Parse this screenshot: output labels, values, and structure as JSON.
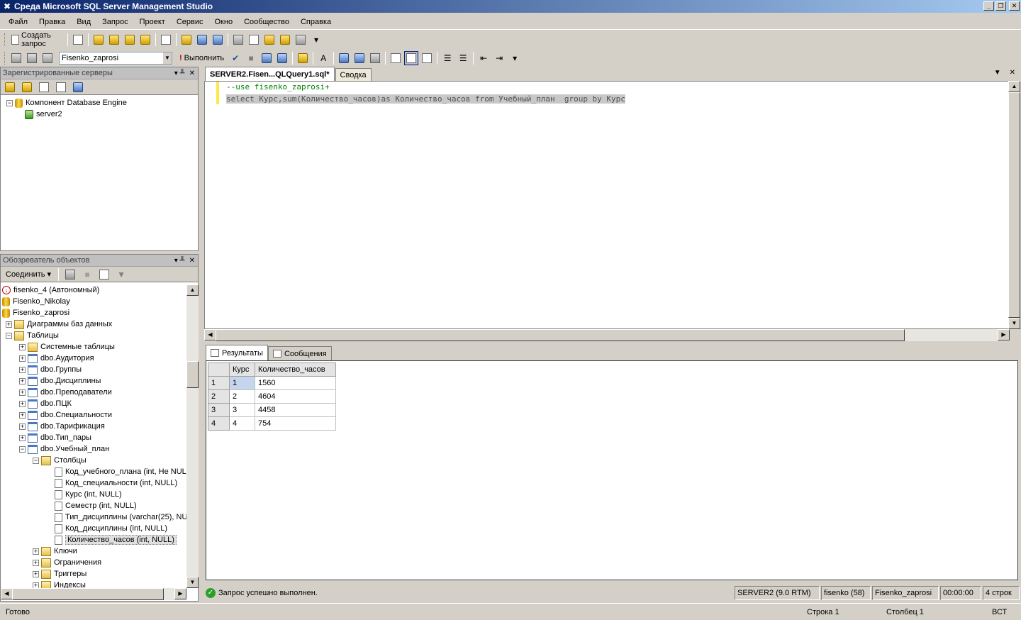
{
  "window": {
    "title": "Среда Microsoft SQL Server Management Studio",
    "minimize": "_",
    "restore": "❐",
    "close": "✕"
  },
  "menu": [
    "Файл",
    "Правка",
    "Вид",
    "Запрос",
    "Проект",
    "Сервис",
    "Окно",
    "Сообщество",
    "Справка"
  ],
  "toolbar": {
    "new_query": "Создать запрос",
    "database": "Fisenko_zaprosi",
    "execute": "Выполнить",
    "dropdown_arrow": "▾"
  },
  "registered_servers": {
    "title": "Зарегистрированные серверы",
    "pin": "▾  ╨",
    "close": "✕",
    "tree": [
      {
        "label": "Компонент Database Engine",
        "expander": "−"
      },
      {
        "label": "server2",
        "expander": ""
      }
    ]
  },
  "object_explorer": {
    "title": "Обозреватель объектов",
    "pin": "▾  ╨",
    "close": "✕",
    "connect": "Соединить ▾",
    "tree": [
      {
        "label": "fisenko_4 (Автономный)",
        "expander": "",
        "icon": "db-error-icon",
        "indent": 0
      },
      {
        "label": "Fisenko_Nikolay",
        "expander": "",
        "icon": "database-icon",
        "indent": 0
      },
      {
        "label": "Fisenko_zaprosi",
        "expander": "",
        "icon": "database-icon",
        "indent": 0
      },
      {
        "label": "Диаграммы баз данных",
        "expander": "+",
        "icon": "folder-icon",
        "indent": 1
      },
      {
        "label": "Таблицы",
        "expander": "−",
        "icon": "folder-icon",
        "indent": 1
      },
      {
        "label": "Системные таблицы",
        "expander": "+",
        "icon": "folder-icon",
        "indent": 2
      },
      {
        "label": "dbo.Аудитория",
        "expander": "+",
        "icon": "table-icon",
        "indent": 2
      },
      {
        "label": "dbo.Группы",
        "expander": "+",
        "icon": "table-icon",
        "indent": 2
      },
      {
        "label": "dbo.Дисциплины",
        "expander": "+",
        "icon": "table-icon",
        "indent": 2
      },
      {
        "label": "dbo.Преподаватели",
        "expander": "+",
        "icon": "table-icon",
        "indent": 2
      },
      {
        "label": "dbo.ПЦК",
        "expander": "+",
        "icon": "table-icon",
        "indent": 2
      },
      {
        "label": "dbo.Специальности",
        "expander": "+",
        "icon": "table-icon",
        "indent": 2
      },
      {
        "label": "dbo.Тарификация",
        "expander": "+",
        "icon": "table-icon",
        "indent": 2
      },
      {
        "label": "dbo.Тип_пары",
        "expander": "+",
        "icon": "table-icon",
        "indent": 2
      },
      {
        "label": "dbo.Учебный_план",
        "expander": "−",
        "icon": "table-icon",
        "indent": 2
      },
      {
        "label": "Столбцы",
        "expander": "−",
        "icon": "folder-icon",
        "indent": 3
      },
      {
        "label": "Код_учебного_плана (int, Не NUL",
        "expander": "",
        "icon": "column-icon",
        "indent": 4
      },
      {
        "label": "Код_специальности (int, NULL)",
        "expander": "",
        "icon": "column-icon",
        "indent": 4
      },
      {
        "label": "Курс (int, NULL)",
        "expander": "",
        "icon": "column-icon",
        "indent": 4
      },
      {
        "label": "Семестр (int, NULL)",
        "expander": "",
        "icon": "column-icon",
        "indent": 4
      },
      {
        "label": "Тип_дисциплины (varchar(25), NU",
        "expander": "",
        "icon": "column-icon",
        "indent": 4
      },
      {
        "label": "Код_дисциплины (int, NULL)",
        "expander": "",
        "icon": "column-icon",
        "indent": 4
      },
      {
        "label": "Количество_часов (int, NULL)",
        "expander": "",
        "icon": "column-icon",
        "indent": 4,
        "selected": true
      },
      {
        "label": "Ключи",
        "expander": "+",
        "icon": "folder-icon",
        "indent": 3
      },
      {
        "label": "Ограничения",
        "expander": "+",
        "icon": "folder-icon",
        "indent": 3
      },
      {
        "label": "Триггеры",
        "expander": "+",
        "icon": "folder-icon",
        "indent": 3
      },
      {
        "label": "Индексы",
        "expander": "+",
        "icon": "folder-icon",
        "indent": 3
      }
    ]
  },
  "editor": {
    "tabs": [
      {
        "label": "SERVER2.Fisen...QLQuery1.sql*",
        "active": true
      },
      {
        "label": "Сводка",
        "active": false
      }
    ],
    "tab_ctrls": {
      "dropdown": "▼",
      "close": "✕"
    },
    "lines": [
      "--use fisenko_zaprosi+",
      "select Курс,sum(Количество_часов)as Количество_часов from Учебный_план  group by Курс"
    ]
  },
  "results": {
    "tabs": [
      "Результаты",
      "Сообщения"
    ],
    "columns": [
      "Курс",
      "Количество_часов"
    ],
    "rows": [
      {
        "n": "1",
        "kurs": "1",
        "hours": "1560"
      },
      {
        "n": "2",
        "kurs": "2",
        "hours": "4604"
      },
      {
        "n": "3",
        "kurs": "3",
        "hours": "4458"
      },
      {
        "n": "4",
        "kurs": "4",
        "hours": "754"
      }
    ]
  },
  "query_status": {
    "message": "Запрос успешно выполнен.",
    "server": "SERVER2 (9.0 RTM)",
    "user": "fisenko (58)",
    "database": "Fisenko_zaprosi",
    "time": "00:00:00",
    "rows": "4 строк"
  },
  "statusbar": {
    "ready": "Готово",
    "line": "Строка 1",
    "col": "Столбец 1",
    "mode": "ВСТ"
  },
  "scroll": {
    "up": "▲",
    "down": "▼",
    "left": "◀",
    "right": "▶"
  },
  "colors": {
    "title_bar": "#0a246a",
    "comment": "#008000",
    "query_ok": "#2aa02a"
  }
}
